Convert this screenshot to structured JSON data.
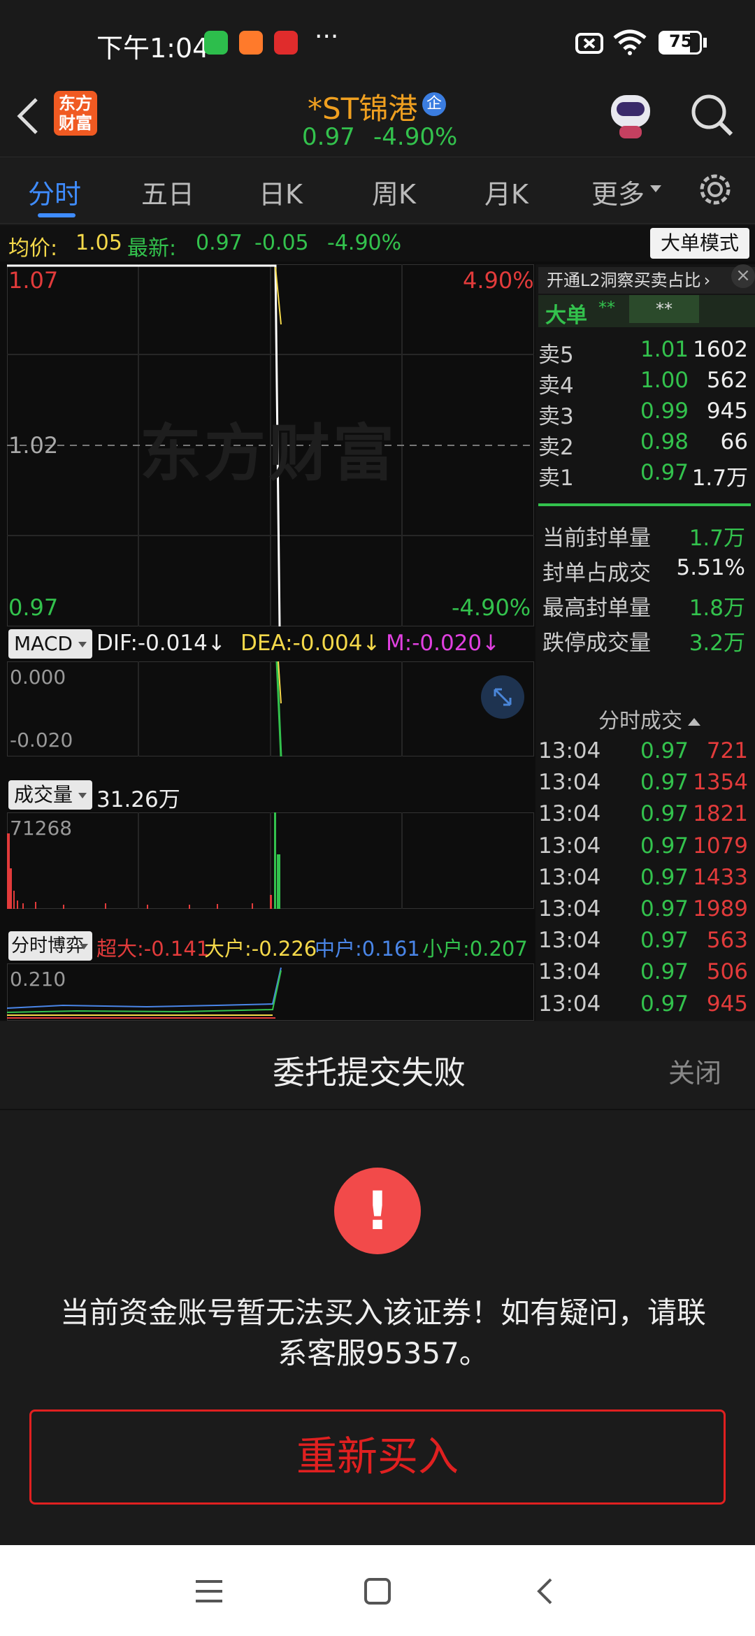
{
  "status_bar": {
    "time": "下午1:04",
    "battery": "75",
    "more": "···"
  },
  "header": {
    "app_logo": "东方财富",
    "stock_name": "*ST锦港",
    "badge": "企",
    "price": "0.97",
    "change_pct": "-4.90%"
  },
  "tabs": [
    {
      "label": "分时",
      "active": true
    },
    {
      "label": "五日"
    },
    {
      "label": "日K"
    },
    {
      "label": "周K"
    },
    {
      "label": "月K"
    },
    {
      "label": "更多"
    }
  ],
  "info_bar": {
    "avg_label": "均价:",
    "avg_value": "1.05",
    "latest_label": "最新:",
    "latest_value": "0.97",
    "change": "-0.05",
    "change_pct": "-4.90%",
    "mode_button": "大单模式"
  },
  "main_chart": {
    "y_top": "1.07",
    "y_mid": "1.02",
    "y_bottom": "0.97",
    "pct_top": "4.90%",
    "pct_bottom": "-4.90%",
    "watermark": "东方财富"
  },
  "macd": {
    "label": "MACD",
    "dif": "DIF:-0.014↓",
    "dea": "DEA:-0.004↓",
    "m": "M:-0.020↓",
    "y_top": "0.000",
    "y_bottom": "-0.020"
  },
  "volume": {
    "label": "成交量",
    "total": "31.26万",
    "y_top": "71268"
  },
  "game": {
    "label": "分时博弈",
    "super": "超大:-0.141",
    "large": "大户:-0.226",
    "medium": "中户:0.161",
    "small": "小户:0.207",
    "y_top": "0.210"
  },
  "right_panel": {
    "l2_link": "开通L2洞察买卖占比",
    "big_order_label": "大单",
    "big_order_v1": "**",
    "big_order_v2": "**",
    "asks": [
      {
        "label": "卖5",
        "price": "1.01",
        "vol": "1602"
      },
      {
        "label": "卖4",
        "price": "1.00",
        "vol": "562"
      },
      {
        "label": "卖3",
        "price": "0.99",
        "vol": "945"
      },
      {
        "label": "卖2",
        "price": "0.98",
        "vol": "66"
      },
      {
        "label": "卖1",
        "price": "0.97",
        "vol": "1.7万"
      }
    ],
    "stats": [
      {
        "label": "当前封单量",
        "value": "1.7万",
        "color": "green"
      },
      {
        "label": "封单占成交",
        "value": "5.51%",
        "color": "white"
      },
      {
        "label": "最高封单量",
        "value": "1.8万",
        "color": "green"
      },
      {
        "label": "跌停成交量",
        "value": "3.2万",
        "color": "green"
      }
    ],
    "ticks_title": "分时成交",
    "ticks": [
      {
        "t": "13:04",
        "p": "0.97",
        "v": "721"
      },
      {
        "t": "13:04",
        "p": "0.97",
        "v": "1354"
      },
      {
        "t": "13:04",
        "p": "0.97",
        "v": "1821"
      },
      {
        "t": "13:04",
        "p": "0.97",
        "v": "1079"
      },
      {
        "t": "13:04",
        "p": "0.97",
        "v": "1433"
      },
      {
        "t": "13:04",
        "p": "0.97",
        "v": "1989"
      },
      {
        "t": "13:04",
        "p": "0.97",
        "v": "563"
      },
      {
        "t": "13:04",
        "p": "0.97",
        "v": "506"
      },
      {
        "t": "13:04",
        "p": "0.97",
        "v": "945"
      }
    ]
  },
  "sheet": {
    "title": "委托提交失败",
    "close": "关闭",
    "message_line1": "当前资金账号暂无法买入该证券！如有疑问，请联",
    "message_line2": "系客服95357。",
    "button": "重新买入"
  }
}
